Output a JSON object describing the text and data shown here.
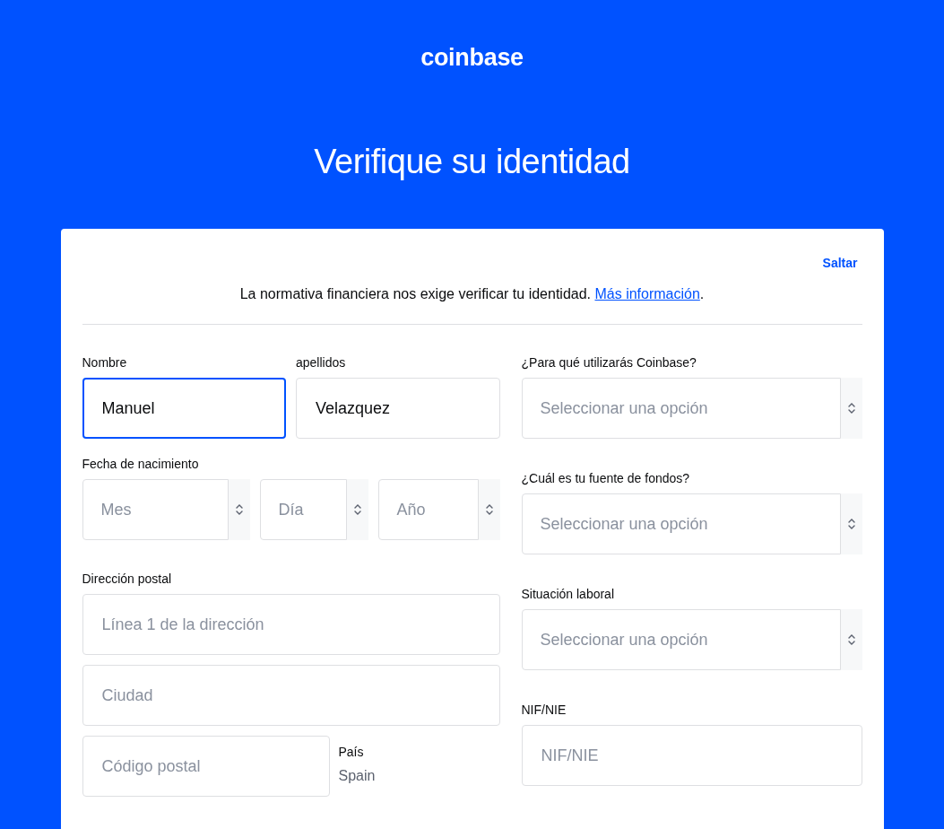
{
  "logo": "coinbase",
  "title": "Verifique su identidad",
  "skip_link": "Saltar",
  "notice": {
    "text": "La normativa financiera nos exige verificar tu identidad.",
    "link": "Más información",
    "end": "."
  },
  "name_fields": [
    {
      "label": "Nombre",
      "value": "Manuel",
      "focused": true
    },
    {
      "label": "apellidos",
      "value": "Velazquez",
      "focused": false
    }
  ],
  "birth_date": {
    "label": "Fecha de nacimiento",
    "selects": [
      {
        "placeholder": "Mes"
      },
      {
        "placeholder": "Día"
      },
      {
        "placeholder": "Año"
      }
    ]
  },
  "address": {
    "label": "Dirección postal",
    "fields": [
      {
        "placeholder": "Línea 1 de la dirección"
      },
      {
        "placeholder": "Ciudad"
      },
      {
        "placeholder": "Código postal"
      }
    ],
    "country": {
      "label": "País",
      "value": "Spain"
    }
  },
  "right_fields": [
    {
      "kind": "select",
      "label": "¿Para qué utilizarás Coinbase?",
      "placeholder": "Seleccionar una opción"
    },
    {
      "kind": "select",
      "label": "¿Cuál es tu fuente de fondos?",
      "placeholder": "Seleccionar una opción"
    },
    {
      "kind": "select",
      "label": "Situación laboral",
      "placeholder": "Seleccionar una opción"
    },
    {
      "kind": "input",
      "label": "NIF/NIE",
      "placeholder": "NIF/NIE"
    }
  ]
}
